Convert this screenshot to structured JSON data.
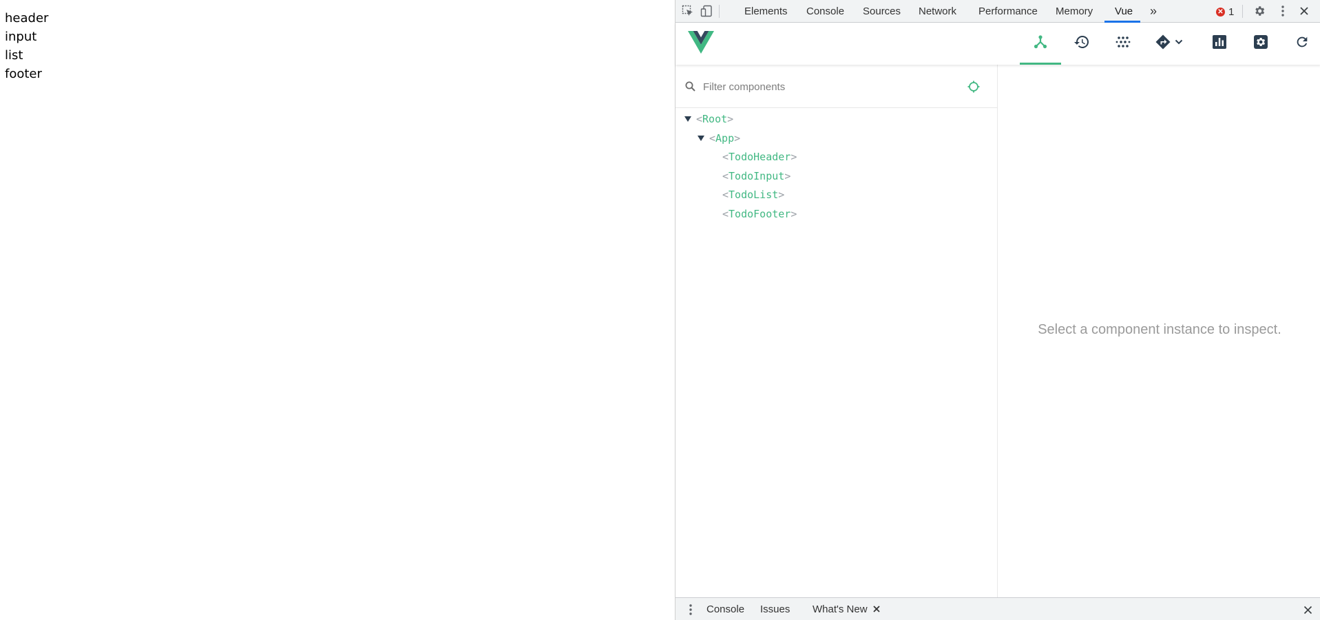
{
  "page": {
    "lines": [
      "header",
      "input",
      "list",
      "footer"
    ]
  },
  "devtools": {
    "tabs": [
      "Elements",
      "Console",
      "Sources",
      "Network",
      "Performance",
      "Memory",
      "Vue"
    ],
    "active_tab": "Vue",
    "more_tabs_glyph": "»",
    "error_count": "1",
    "error_glyph": "✕",
    "accent_color": "#1a73e8"
  },
  "vue_toolbar": {
    "accent_color": "#42b883",
    "buttons": [
      {
        "icon": "components-icon",
        "active": true
      },
      {
        "icon": "timeline-icon",
        "active": false
      },
      {
        "icon": "vuex-icon",
        "active": false
      },
      {
        "icon": "router-icon",
        "active": false
      },
      {
        "icon": "performance-icon",
        "active": false
      },
      {
        "icon": "settings-icon",
        "active": false
      },
      {
        "icon": "refresh-icon",
        "active": false
      }
    ]
  },
  "component_tree": {
    "filter_placeholder": "Filter components",
    "open_bracket": "<",
    "close_bracket": ">",
    "nodes": [
      {
        "name": "Root",
        "depth": 0,
        "expanded": true
      },
      {
        "name": "App",
        "depth": 1,
        "expanded": true
      },
      {
        "name": "TodoHeader",
        "depth": 2,
        "expanded": false
      },
      {
        "name": "TodoInput",
        "depth": 2,
        "expanded": false
      },
      {
        "name": "TodoList",
        "depth": 2,
        "expanded": false
      },
      {
        "name": "TodoFooter",
        "depth": 2,
        "expanded": false
      }
    ]
  },
  "inspector": {
    "empty_message": "Select a component instance to inspect."
  },
  "drawer": {
    "tabs": [
      "Console",
      "Issues",
      "What's New"
    ],
    "close_glyph": "✕"
  }
}
